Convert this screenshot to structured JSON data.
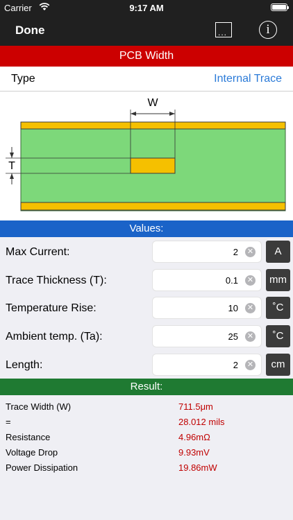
{
  "status": {
    "carrier": "Carrier",
    "time": "9:17 AM"
  },
  "nav": {
    "done": "Done",
    "more_icon": "more-icon",
    "info_icon": "info-icon",
    "info_glyph": "i"
  },
  "title": "PCB Width",
  "type_row": {
    "label": "Type",
    "value": "Internal Trace"
  },
  "diagram": {
    "w_label": "W",
    "t_label": "T"
  },
  "values_header": "Values:",
  "inputs": [
    {
      "label": "Max Current:",
      "value": "2",
      "unit": "A"
    },
    {
      "label": "Trace Thickness (T):",
      "value": "0.1",
      "unit": "mm"
    },
    {
      "label": "Temperature Rise:",
      "value": "10",
      "unit": "˚C"
    },
    {
      "label": "Ambient temp. (Ta):",
      "value": "25",
      "unit": "˚C"
    },
    {
      "label": "Length:",
      "value": "2",
      "unit": "cm"
    }
  ],
  "result_header": "Result:",
  "results": [
    {
      "key": "Trace Width (W)",
      "value": "711.5μm"
    },
    {
      "key": "=",
      "value": "28.012 mils"
    },
    {
      "key": "Resistance",
      "value": "4.96mΩ"
    },
    {
      "key": "Voltage Drop",
      "value": "9.93mV"
    },
    {
      "key": "Power Dissipation",
      "value": "19.86mW"
    }
  ],
  "colors": {
    "nav": "#202020",
    "title": "#cc0000",
    "values": "#1a63c8",
    "result": "#1f7a32",
    "link": "#2a7ad8",
    "result_value": "#c00000",
    "board": "#7dd87a",
    "copper": "#f5c000"
  }
}
